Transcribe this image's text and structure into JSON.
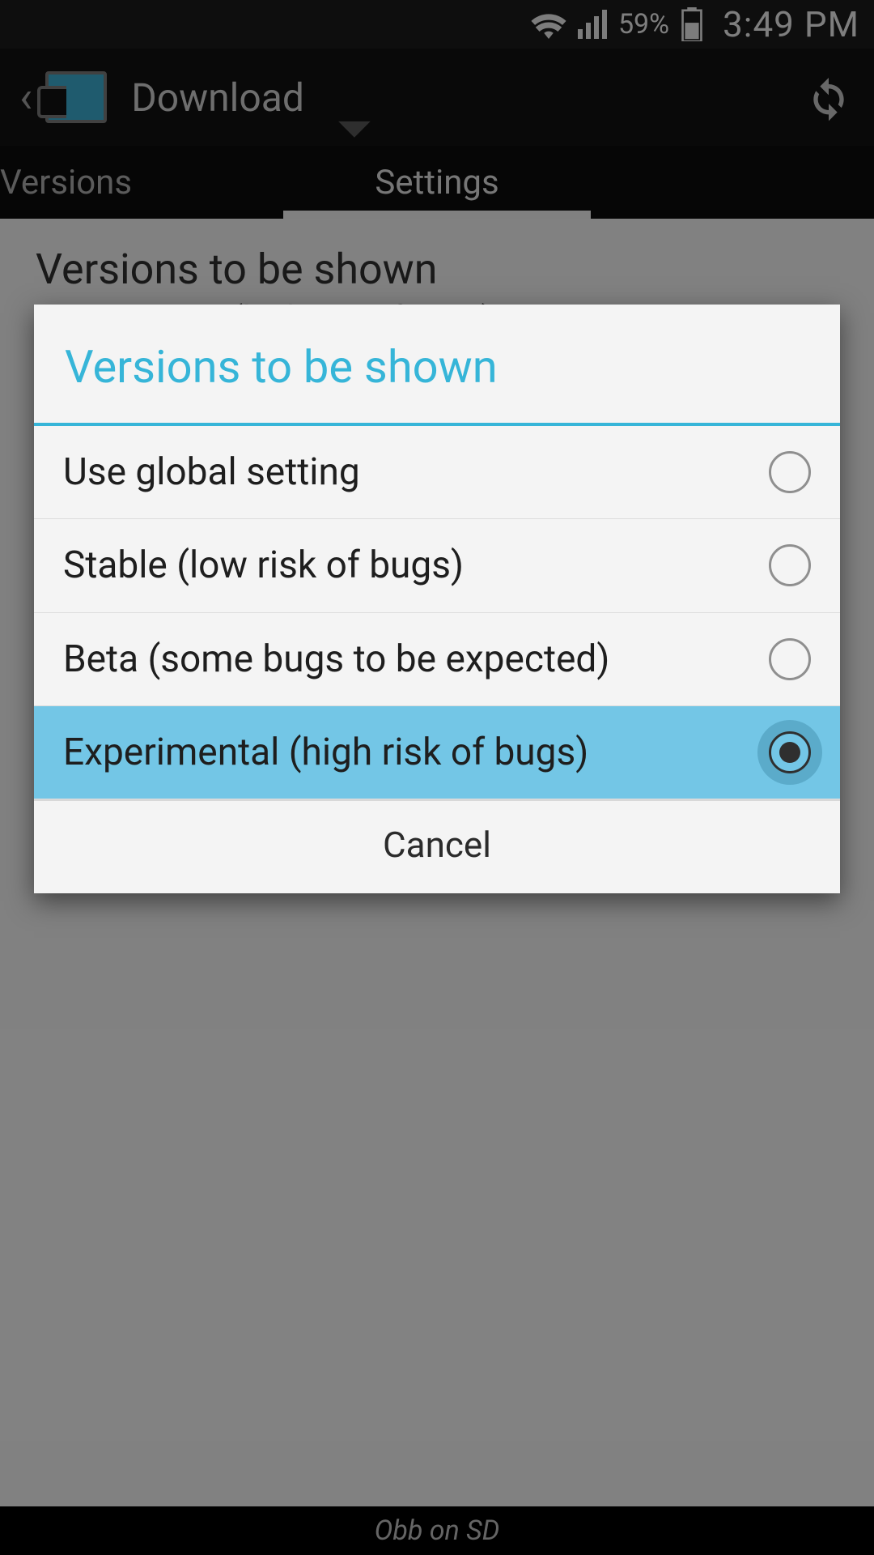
{
  "status": {
    "battery_pct": "59%",
    "clock": "3:49 PM"
  },
  "actionbar": {
    "title": "Download"
  },
  "tabs": {
    "versions": "Versions",
    "settings": "Settings"
  },
  "pref": {
    "title": "Versions to be shown",
    "subtitle": "Experimental (high risk of bugs)"
  },
  "bottom": {
    "label": "Obb on SD"
  },
  "dialog": {
    "title": "Versions to be shown",
    "options": [
      "Use global setting",
      "Stable (low risk of bugs)",
      "Beta (some bugs to be expected)",
      "Experimental (high risk of bugs)"
    ],
    "cancel": "Cancel"
  }
}
